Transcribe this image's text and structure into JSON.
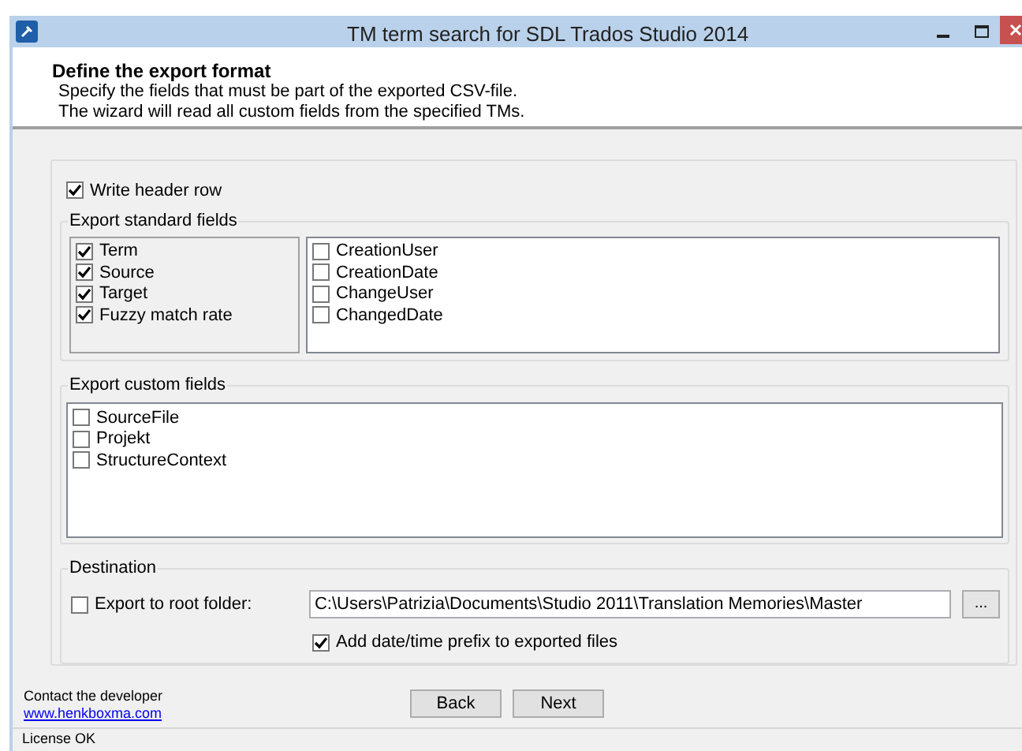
{
  "window": {
    "title": "TM term search for SDL Trados Studio 2014"
  },
  "header": {
    "title": "Define the export format",
    "lines": [
      "Specify the fields that must be part of the exported CSV-file.",
      "The wizard will read all custom fields from the specified TMs."
    ]
  },
  "write_header_row": {
    "label": "Write header row",
    "checked": true
  },
  "standard_fields": {
    "title": "Export standard fields",
    "fixed": [
      {
        "label": "Term",
        "checked": true
      },
      {
        "label": "Source",
        "checked": true
      },
      {
        "label": "Target",
        "checked": true
      },
      {
        "label": "Fuzzy match rate",
        "checked": true
      }
    ],
    "optional": [
      {
        "label": "CreationUser",
        "checked": false
      },
      {
        "label": "CreationDate",
        "checked": false
      },
      {
        "label": "ChangeUser",
        "checked": false
      },
      {
        "label": "ChangedDate",
        "checked": false
      }
    ]
  },
  "custom_fields": {
    "title": "Export custom fields",
    "items": [
      {
        "label": "SourceFile",
        "checked": false
      },
      {
        "label": "Projekt",
        "checked": false
      },
      {
        "label": "StructureContext",
        "checked": false
      }
    ]
  },
  "destination": {
    "title": "Destination",
    "export_to_root": {
      "label": "Export to root folder:",
      "checked": false
    },
    "path": "C:\\Users\\Patrizia\\Documents\\Studio 2011\\Translation Memories\\Master",
    "browse": "...",
    "prefix": {
      "label": "Add date/time prefix to exported files",
      "checked": true
    }
  },
  "footer": {
    "contact": "Contact the developer",
    "link": "www.henkboxma.com",
    "buttons": [
      "Back",
      "Next"
    ]
  },
  "status_bar": "License OK"
}
